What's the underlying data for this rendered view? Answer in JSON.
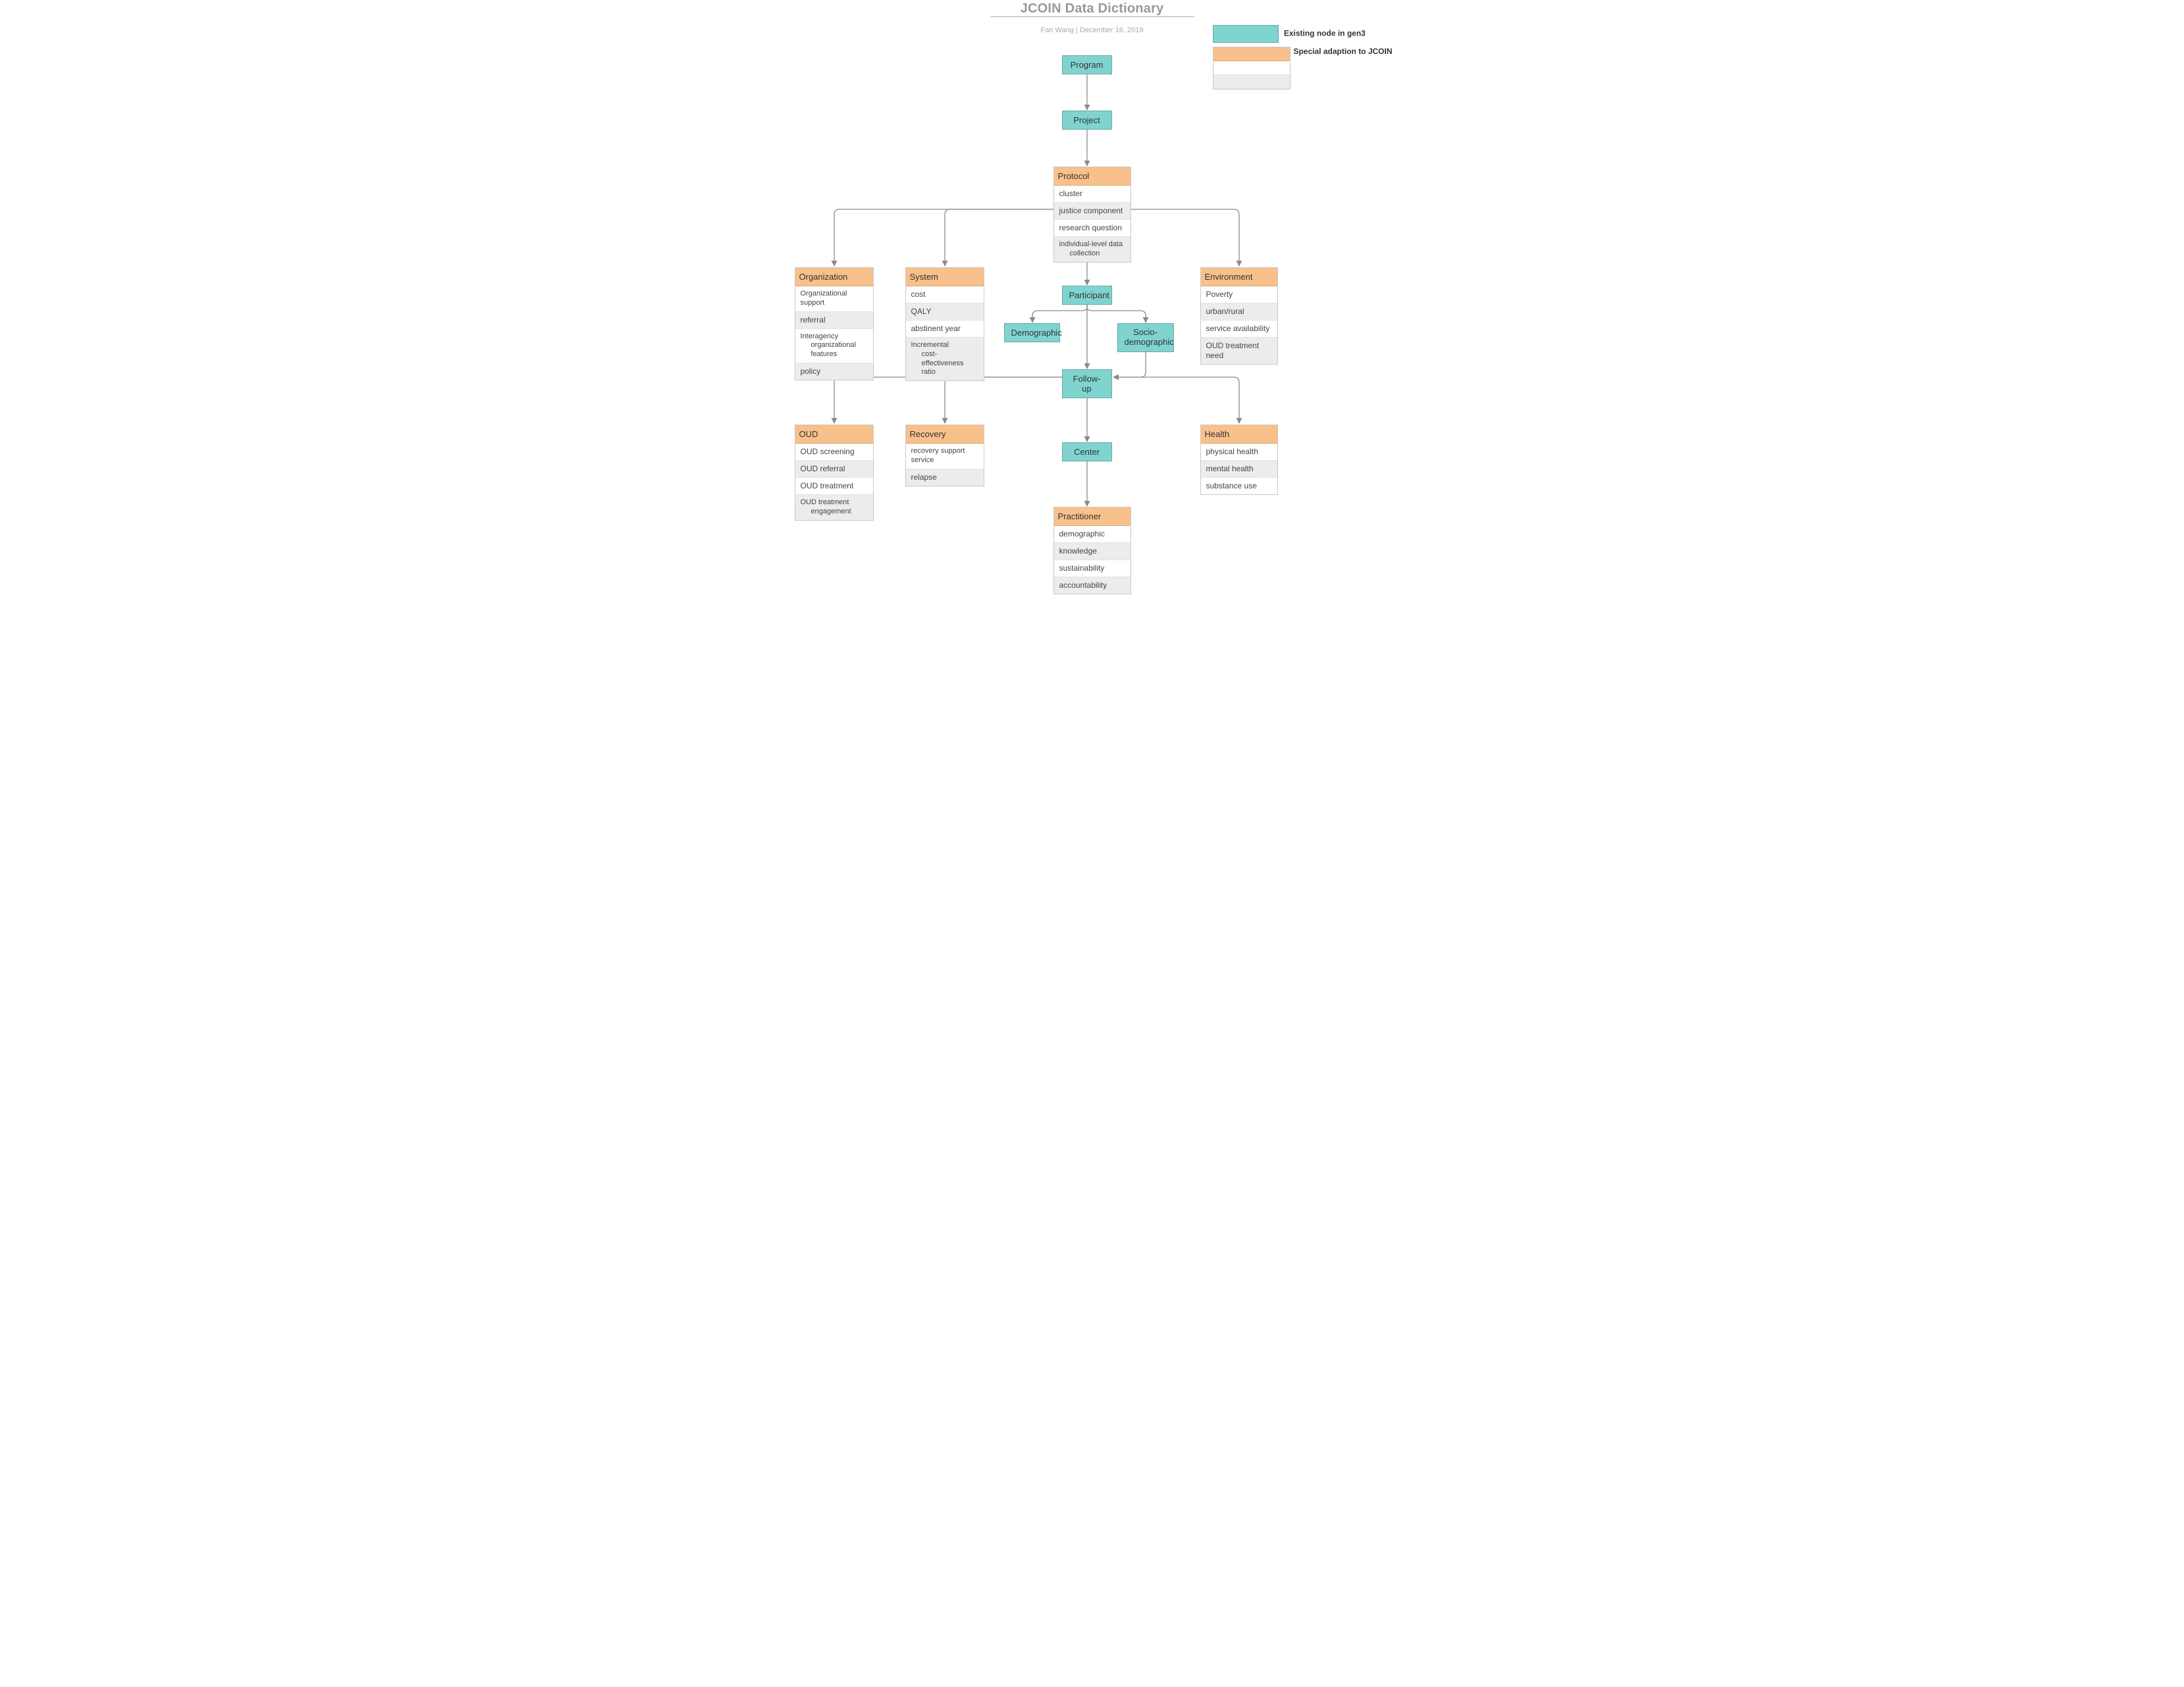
{
  "title": "JCOIN Data Dictionary",
  "author": "Fan Wang",
  "date": "December 16, 2019",
  "byline_sep": "  |  ",
  "legend": {
    "existing": "Existing node in gen3",
    "special": "Special adaption to JCOIN"
  },
  "nodes": {
    "program": {
      "label": "Program"
    },
    "project": {
      "label": "Project"
    },
    "participant": {
      "label": "Participant"
    },
    "demographic": {
      "label": "Demographic"
    },
    "socio": {
      "label1": "Socio-",
      "label2": "demographic"
    },
    "followup": {
      "label": "Follow-up"
    },
    "center": {
      "label": "Center"
    }
  },
  "tables": {
    "protocol": {
      "title": "Protocol",
      "rows": [
        "cluster",
        "justice component",
        "research question",
        "individual-level data",
        "  collection"
      ]
    },
    "organization": {
      "title": "Organization",
      "rows": [
        "Organizational support",
        "referral",
        "Interagency",
        "  organizational features",
        "policy"
      ]
    },
    "system": {
      "title": "System",
      "rows": [
        "cost",
        "QALY",
        "abstinent year",
        "Incremental",
        "  cost-effectiveness ratio"
      ]
    },
    "environment": {
      "title": "Environment",
      "rows": [
        "Poverty",
        "urban/rural",
        "service availability",
        "OUD treatment need"
      ]
    },
    "oud": {
      "title": "OUD",
      "rows": [
        "OUD screening",
        "OUD referral",
        "OUD treatment",
        "OUD treatment",
        "  engagement"
      ]
    },
    "recovery": {
      "title": "Recovery",
      "rows": [
        "recovery support service",
        "relapse"
      ]
    },
    "health": {
      "title": "Health",
      "rows": [
        "physical health",
        "mental health",
        "substance use"
      ]
    },
    "practitioner": {
      "title": "Practitioner",
      "rows": [
        "demographic",
        "knowledge",
        "sustainability",
        "accountability"
      ]
    }
  }
}
